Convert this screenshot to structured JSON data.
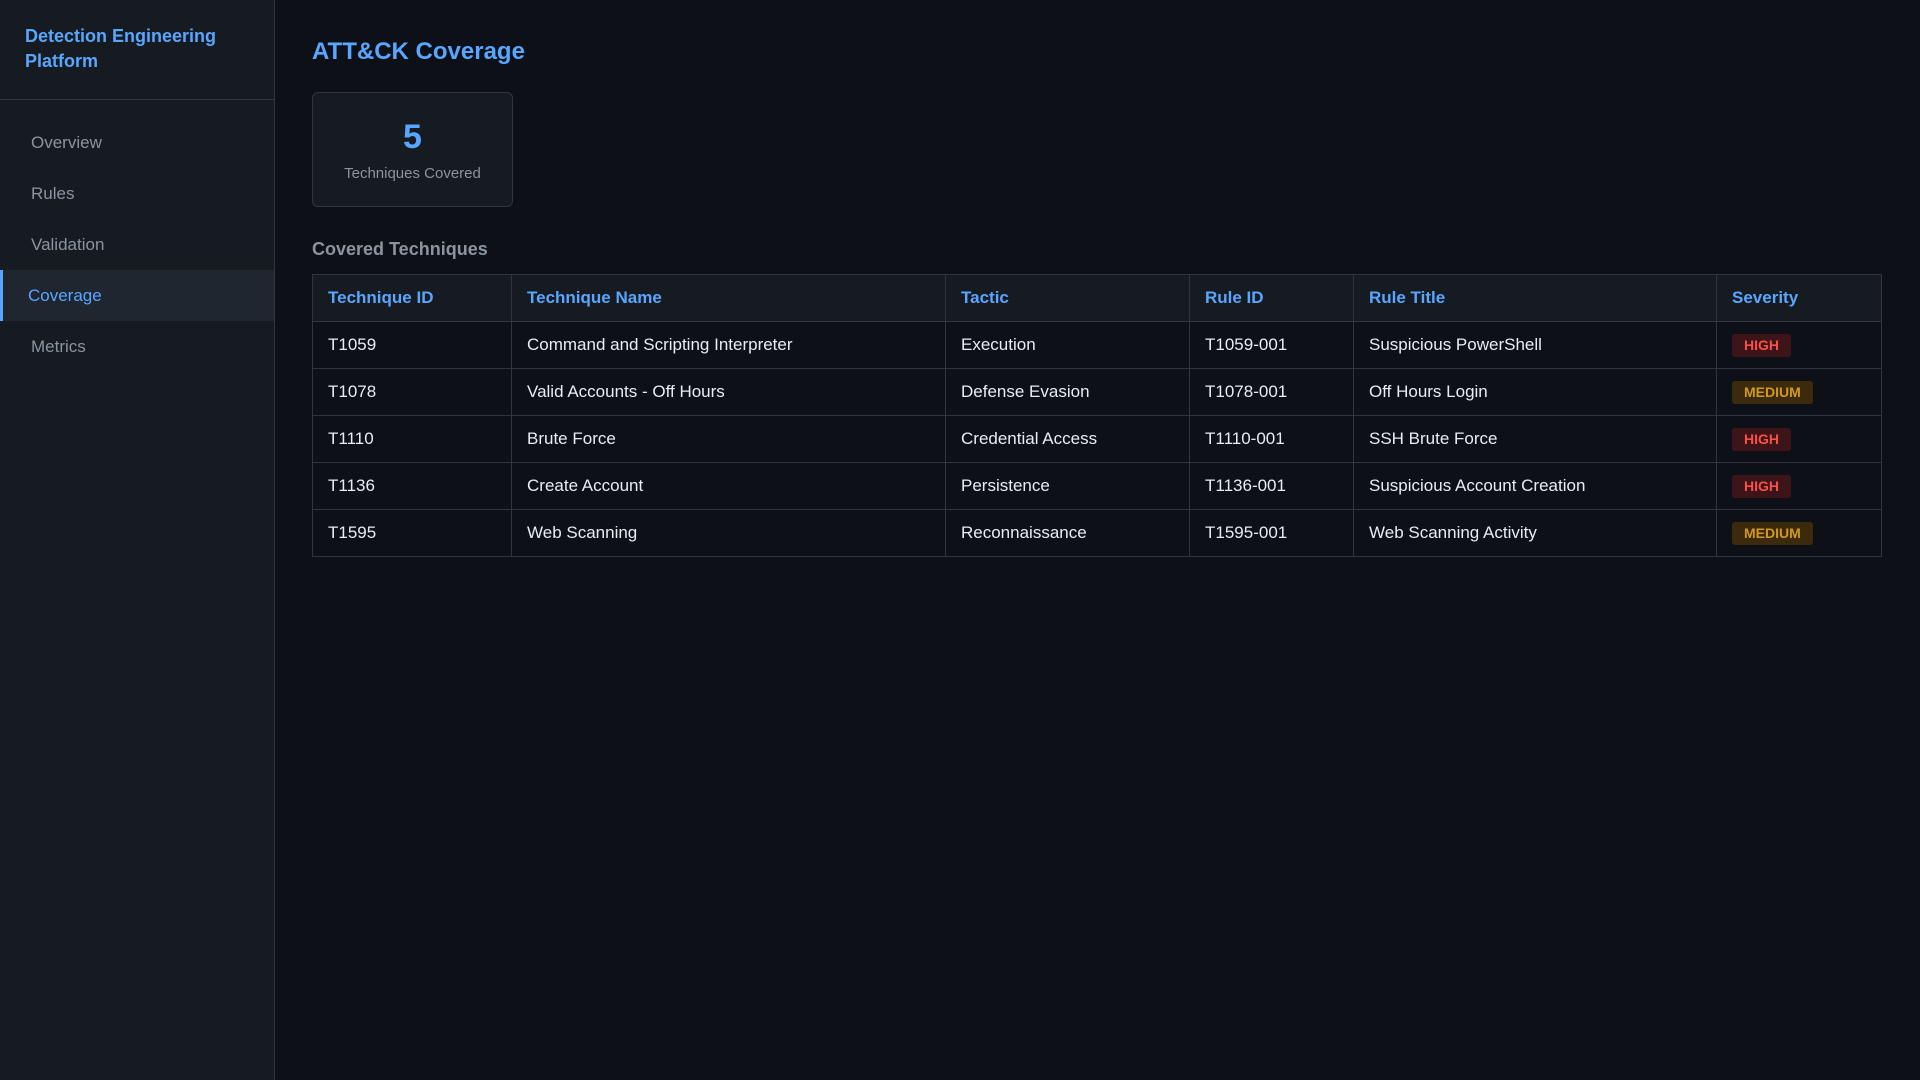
{
  "app": {
    "title": "Detection Engineering Platform"
  },
  "nav": {
    "items": [
      {
        "label": "Overview"
      },
      {
        "label": "Rules"
      },
      {
        "label": "Validation"
      },
      {
        "label": "Coverage",
        "active": true
      },
      {
        "label": "Metrics"
      }
    ]
  },
  "page": {
    "title": "ATT&CK Coverage"
  },
  "stats": {
    "value": "5",
    "label": "Techniques Covered"
  },
  "section": {
    "title": "Covered Techniques"
  },
  "table": {
    "headers": [
      "Technique ID",
      "Technique Name",
      "Tactic",
      "Rule ID",
      "Rule Title",
      "Severity"
    ],
    "rows": [
      [
        "T1059",
        "Command and Scripting Interpreter",
        "Execution",
        "T1059-001",
        "Suspicious PowerShell",
        "HIGH"
      ],
      [
        "T1078",
        "Valid Accounts - Off Hours",
        "Defense Evasion",
        "T1078-001",
        "Off Hours Login",
        "MEDIUM"
      ],
      [
        "T1110",
        "Brute Force",
        "Credential Access",
        "T1110-001",
        "SSH Brute Force",
        "HIGH"
      ],
      [
        "T1136",
        "Create Account",
        "Persistence",
        "T1136-001",
        "Suspicious Account Creation",
        "HIGH"
      ],
      [
        "T1595",
        "Web Scanning",
        "Reconnaissance",
        "T1595-001",
        "Web Scanning Activity",
        "MEDIUM"
      ]
    ]
  },
  "colors": {
    "accent": "#58a6ff",
    "background": "#0d1117",
    "sidebar": "#161b22",
    "high": "#f85149",
    "medium": "#d29922"
  }
}
